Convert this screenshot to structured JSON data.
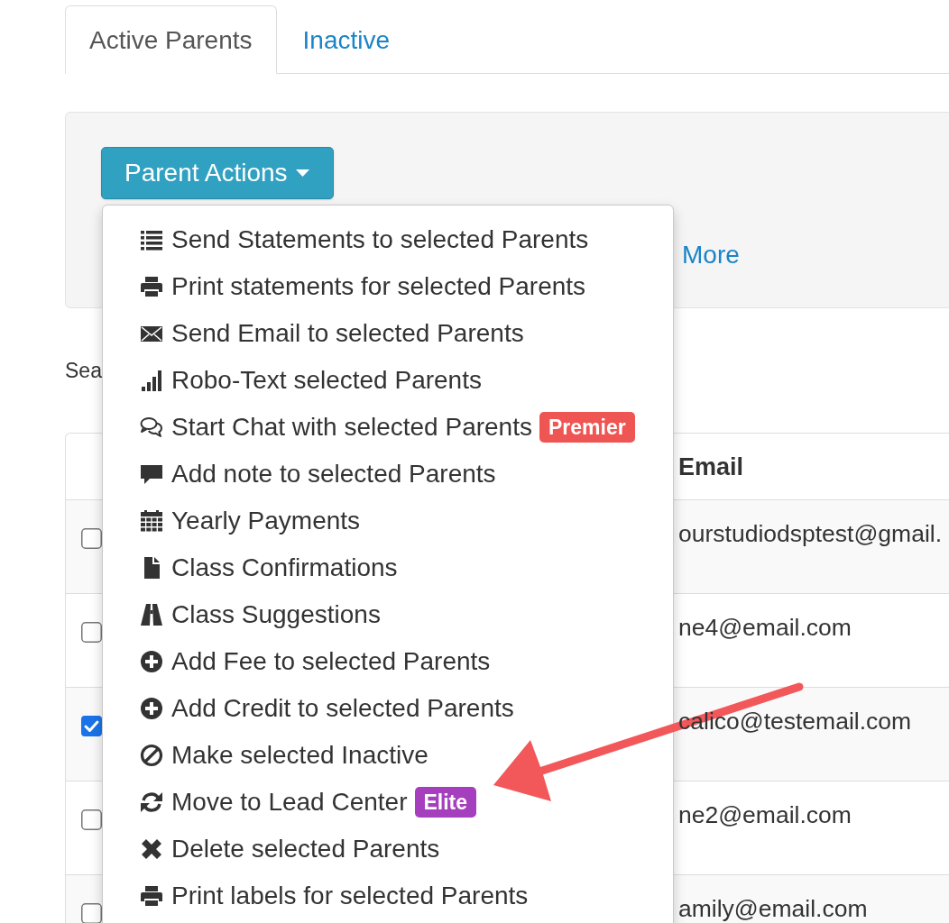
{
  "tabs": [
    {
      "label": "Active Parents",
      "selected": true
    },
    {
      "label": "Inactive",
      "selected": false
    }
  ],
  "actions_panel": {
    "button": "Parent Actions",
    "link": "More"
  },
  "search_label": "Sea",
  "table": {
    "email_header": "Email",
    "rows": [
      {
        "checked": false,
        "email": "ourstudiodsptest@gmail."
      },
      {
        "checked": false,
        "email": "ne4@email.com"
      },
      {
        "checked": true,
        "email": "calico@testemail.com"
      },
      {
        "checked": false,
        "email": "ne2@email.com"
      },
      {
        "checked": false,
        "email": "amily@email.com"
      }
    ]
  },
  "menu": {
    "items": [
      {
        "label": "Send Statements to selected Parents"
      },
      {
        "label": "Print statements for selected Parents"
      },
      {
        "label": "Send Email to selected Parents"
      },
      {
        "label": "Robo-Text selected Parents"
      },
      {
        "label": "Start Chat with selected Parents",
        "badge": {
          "text": "Premier",
          "color": "#ef5552"
        }
      },
      {
        "label": "Add note to selected Parents"
      },
      {
        "label": "Yearly Payments"
      },
      {
        "label": "Class Confirmations"
      },
      {
        "label": "Class Suggestions"
      },
      {
        "label": "Add Fee to selected Parents"
      },
      {
        "label": "Add Credit to selected Parents"
      },
      {
        "label": "Make selected Inactive"
      },
      {
        "label": "Move to Lead Center",
        "badge": {
          "text": "Elite",
          "color": "#a63fbd"
        }
      },
      {
        "label": "Delete selected Parents"
      },
      {
        "label": "Print labels for selected Parents"
      }
    ]
  },
  "annotations": [
    {
      "kind": "arrow"
    }
  ]
}
